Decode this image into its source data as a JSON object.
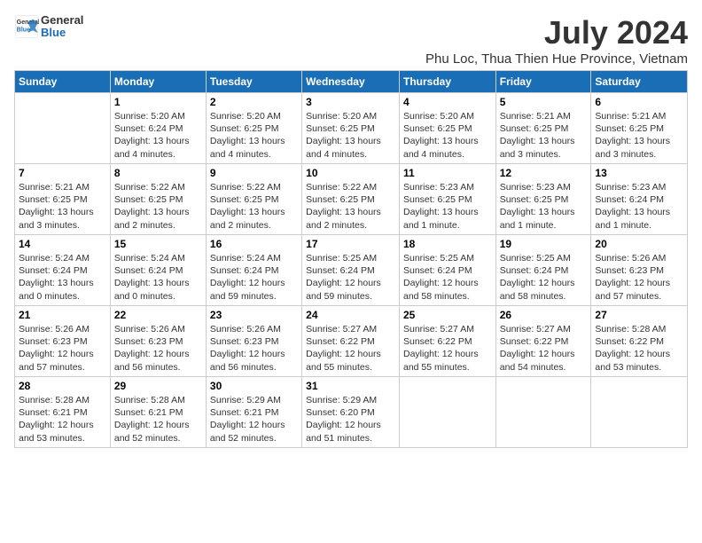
{
  "header": {
    "logo_line1": "General",
    "logo_line2": "Blue",
    "title": "July 2024",
    "subtitle": "Phu Loc, Thua Thien Hue Province, Vietnam"
  },
  "columns": [
    "Sunday",
    "Monday",
    "Tuesday",
    "Wednesday",
    "Thursday",
    "Friday",
    "Saturday"
  ],
  "weeks": [
    [
      {
        "day": "",
        "info": ""
      },
      {
        "day": "1",
        "info": "Sunrise: 5:20 AM\nSunset: 6:24 PM\nDaylight: 13 hours\nand 4 minutes."
      },
      {
        "day": "2",
        "info": "Sunrise: 5:20 AM\nSunset: 6:25 PM\nDaylight: 13 hours\nand 4 minutes."
      },
      {
        "day": "3",
        "info": "Sunrise: 5:20 AM\nSunset: 6:25 PM\nDaylight: 13 hours\nand 4 minutes."
      },
      {
        "day": "4",
        "info": "Sunrise: 5:20 AM\nSunset: 6:25 PM\nDaylight: 13 hours\nand 4 minutes."
      },
      {
        "day": "5",
        "info": "Sunrise: 5:21 AM\nSunset: 6:25 PM\nDaylight: 13 hours\nand 3 minutes."
      },
      {
        "day": "6",
        "info": "Sunrise: 5:21 AM\nSunset: 6:25 PM\nDaylight: 13 hours\nand 3 minutes."
      }
    ],
    [
      {
        "day": "7",
        "info": "Sunrise: 5:21 AM\nSunset: 6:25 PM\nDaylight: 13 hours\nand 3 minutes."
      },
      {
        "day": "8",
        "info": "Sunrise: 5:22 AM\nSunset: 6:25 PM\nDaylight: 13 hours\nand 2 minutes."
      },
      {
        "day": "9",
        "info": "Sunrise: 5:22 AM\nSunset: 6:25 PM\nDaylight: 13 hours\nand 2 minutes."
      },
      {
        "day": "10",
        "info": "Sunrise: 5:22 AM\nSunset: 6:25 PM\nDaylight: 13 hours\nand 2 minutes."
      },
      {
        "day": "11",
        "info": "Sunrise: 5:23 AM\nSunset: 6:25 PM\nDaylight: 13 hours\nand 1 minute."
      },
      {
        "day": "12",
        "info": "Sunrise: 5:23 AM\nSunset: 6:25 PM\nDaylight: 13 hours\nand 1 minute."
      },
      {
        "day": "13",
        "info": "Sunrise: 5:23 AM\nSunset: 6:24 PM\nDaylight: 13 hours\nand 1 minute."
      }
    ],
    [
      {
        "day": "14",
        "info": "Sunrise: 5:24 AM\nSunset: 6:24 PM\nDaylight: 13 hours\nand 0 minutes."
      },
      {
        "day": "15",
        "info": "Sunrise: 5:24 AM\nSunset: 6:24 PM\nDaylight: 13 hours\nand 0 minutes."
      },
      {
        "day": "16",
        "info": "Sunrise: 5:24 AM\nSunset: 6:24 PM\nDaylight: 12 hours\nand 59 minutes."
      },
      {
        "day": "17",
        "info": "Sunrise: 5:25 AM\nSunset: 6:24 PM\nDaylight: 12 hours\nand 59 minutes."
      },
      {
        "day": "18",
        "info": "Sunrise: 5:25 AM\nSunset: 6:24 PM\nDaylight: 12 hours\nand 58 minutes."
      },
      {
        "day": "19",
        "info": "Sunrise: 5:25 AM\nSunset: 6:24 PM\nDaylight: 12 hours\nand 58 minutes."
      },
      {
        "day": "20",
        "info": "Sunrise: 5:26 AM\nSunset: 6:23 PM\nDaylight: 12 hours\nand 57 minutes."
      }
    ],
    [
      {
        "day": "21",
        "info": "Sunrise: 5:26 AM\nSunset: 6:23 PM\nDaylight: 12 hours\nand 57 minutes."
      },
      {
        "day": "22",
        "info": "Sunrise: 5:26 AM\nSunset: 6:23 PM\nDaylight: 12 hours\nand 56 minutes."
      },
      {
        "day": "23",
        "info": "Sunrise: 5:26 AM\nSunset: 6:23 PM\nDaylight: 12 hours\nand 56 minutes."
      },
      {
        "day": "24",
        "info": "Sunrise: 5:27 AM\nSunset: 6:22 PM\nDaylight: 12 hours\nand 55 minutes."
      },
      {
        "day": "25",
        "info": "Sunrise: 5:27 AM\nSunset: 6:22 PM\nDaylight: 12 hours\nand 55 minutes."
      },
      {
        "day": "26",
        "info": "Sunrise: 5:27 AM\nSunset: 6:22 PM\nDaylight: 12 hours\nand 54 minutes."
      },
      {
        "day": "27",
        "info": "Sunrise: 5:28 AM\nSunset: 6:22 PM\nDaylight: 12 hours\nand 53 minutes."
      }
    ],
    [
      {
        "day": "28",
        "info": "Sunrise: 5:28 AM\nSunset: 6:21 PM\nDaylight: 12 hours\nand 53 minutes."
      },
      {
        "day": "29",
        "info": "Sunrise: 5:28 AM\nSunset: 6:21 PM\nDaylight: 12 hours\nand 52 minutes."
      },
      {
        "day": "30",
        "info": "Sunrise: 5:29 AM\nSunset: 6:21 PM\nDaylight: 12 hours\nand 52 minutes."
      },
      {
        "day": "31",
        "info": "Sunrise: 5:29 AM\nSunset: 6:20 PM\nDaylight: 12 hours\nand 51 minutes."
      },
      {
        "day": "",
        "info": ""
      },
      {
        "day": "",
        "info": ""
      },
      {
        "day": "",
        "info": ""
      }
    ]
  ]
}
